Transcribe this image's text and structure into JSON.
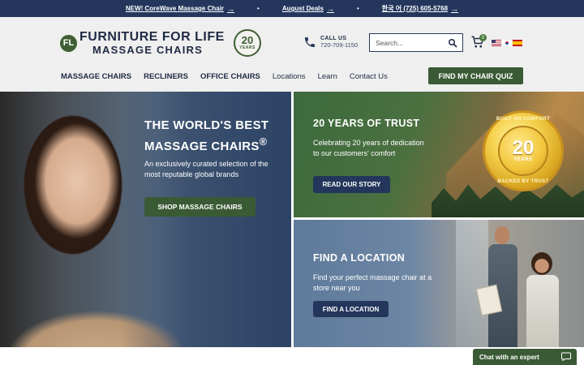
{
  "topbar": {
    "link1": "NEW! CoreWave Massage Chair",
    "link2": "August Deals",
    "link3": "한국 어 (725) 605-5768",
    "separator": "•",
    "arrow": "→"
  },
  "header": {
    "logo_mark": "FL",
    "logo_line1": "FURNITURE FOR LIFE",
    "logo_line2": "MASSAGE CHAIRS",
    "badge_number": "20",
    "badge_label": "YEARS",
    "call_label": "CALL US",
    "call_number": "720-709-1150",
    "search_placeholder": "Search...",
    "cart_count": "0",
    "flags": [
      "us-flag-icon",
      "kr-flag-icon",
      "es-flag-icon"
    ]
  },
  "nav": {
    "items": [
      "MASSAGE CHAIRS",
      "RECLINERS",
      "OFFICE CHAIRS",
      "Locations",
      "Learn",
      "Contact Us"
    ],
    "quiz_button": "FIND MY CHAIR QUIZ"
  },
  "hero_left": {
    "title_line1": "THE WORLD'S BEST",
    "title_line2": "MASSAGE CHAIRS",
    "title_reg": "®",
    "subtitle": "An exclusively curated selection of the most reputable global brands",
    "button": "SHOP MASSAGE CHAIRS"
  },
  "hero_right_top": {
    "title": "20 YEARS OF TRUST",
    "subtitle": "Celebrating 20 years of dedication to our customers' comfort",
    "button": "READ OUR STORY",
    "medal_top": "BUILT ON COMFORT",
    "medal_number": "20",
    "medal_label": "YEARS",
    "medal_bottom": "BACKED BY TRUST"
  },
  "hero_right_bottom": {
    "title": "FIND A LOCATION",
    "subtitle": "Find your perfect massage chair at a store near you",
    "button": "FIND A LOCATION"
  },
  "chat": {
    "label": "Chat with an expert"
  },
  "colors": {
    "navy": "#24365c",
    "green": "#3a5a35",
    "header_bg": "#efefef"
  }
}
